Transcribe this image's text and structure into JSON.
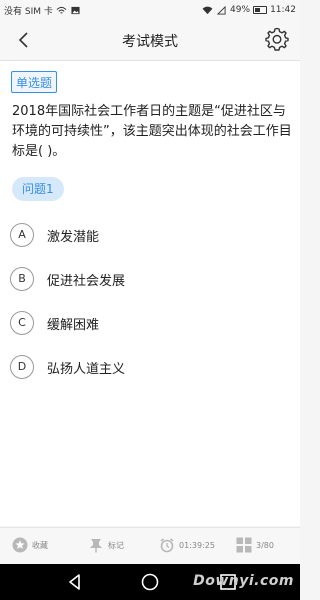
{
  "status_bar": {
    "carrier": "没有 SIM 卡",
    "battery": "49%",
    "time": "11:42"
  },
  "header": {
    "title": "考试模式",
    "back_icon": "chevron-left-icon",
    "settings_icon": "gear-icon"
  },
  "question": {
    "type_label": "单选题",
    "text": "2018年国际社会工作者日的主题是“促进社区与环境的可持续性”，该主题突出体现的社会工作目标是( )。",
    "number_label": "问题1",
    "options": [
      {
        "letter": "A",
        "text": "激发潜能"
      },
      {
        "letter": "B",
        "text": "促进社会发展"
      },
      {
        "letter": "C",
        "text": "缓解困难"
      },
      {
        "letter": "D",
        "text": "弘扬人道主义"
      }
    ]
  },
  "toolbar": {
    "favorite_label": "收藏",
    "mark_label": "标记",
    "timer": "01:39:25",
    "progress": "3/80"
  },
  "watermark": "Downyi.com",
  "colors": {
    "accent": "#3a8ee6",
    "accent_bg": "#d6e9fb"
  }
}
